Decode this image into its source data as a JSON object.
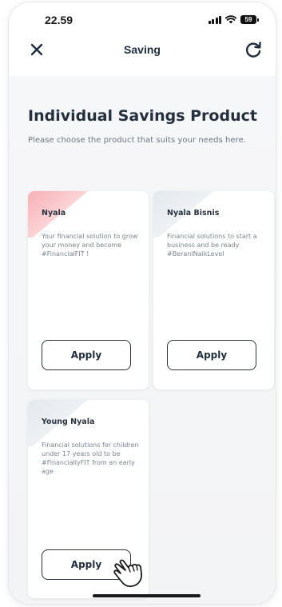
{
  "status_bar": {
    "time": "22.59",
    "battery": "59"
  },
  "header": {
    "title": "Saving"
  },
  "page": {
    "title": "Individual Savings Product",
    "subtitle": "Please choose the product that suits your needs here."
  },
  "products": [
    {
      "name": "Nyala",
      "description": "Your financial solution to grow your money and become #FinancialFIT !",
      "button": "Apply"
    },
    {
      "name": "Nyala Bisnis",
      "description": "Financial solutions to start a business and be ready #BeraniNaikLevel",
      "button": "Apply"
    },
    {
      "name": "Young Nyala",
      "description": "Financial solutions for children under 17 years old to be #FinanciallyFIT from an early age",
      "button": "Apply"
    }
  ],
  "colors": {
    "accent_pink": "#f7b0b5",
    "text_dark": "#1f2d3d",
    "text_muted": "#7b8590"
  },
  "icons": [
    "close-icon",
    "refresh-icon",
    "signal-icon",
    "wifi-icon",
    "battery-icon",
    "hand-pointer-icon"
  ]
}
